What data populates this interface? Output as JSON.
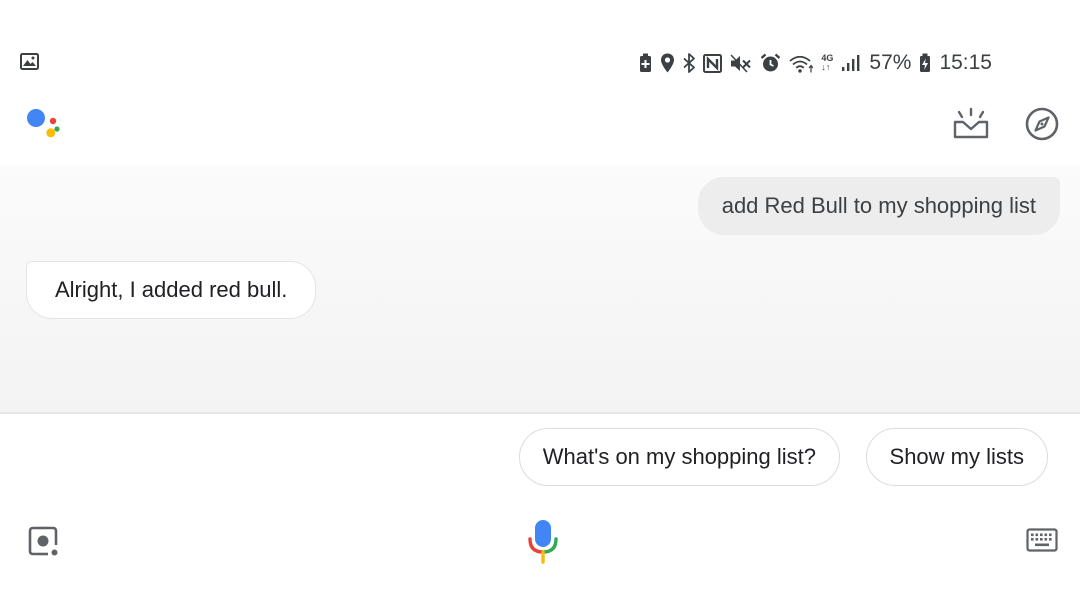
{
  "status_bar": {
    "left_icon": "image-notification-icon",
    "icons": [
      "battery-saver-icon",
      "location-icon",
      "bluetooth-icon",
      "nfc-icon",
      "mute-icon",
      "alarm-icon",
      "wifi-icon",
      "network-4g-icon",
      "signal-icon"
    ],
    "network_top": "4G",
    "network_bottom": "↓↑",
    "battery_percent": "57%",
    "time": "15:15"
  },
  "header": {
    "logo_icon": "google-assistant-logo",
    "updates_icon": "updates-icon",
    "explore_icon": "explore-compass-icon"
  },
  "conversation": {
    "user_message": "add Red Bull to my shopping list",
    "assistant_reply": "Alright, I added red bull."
  },
  "suggestions": [
    "What's on my shopping list?",
    "Show my lists"
  ],
  "bottom_bar": {
    "lens_icon": "lens-icon",
    "mic_icon": "microphone-icon",
    "keyboard_icon": "keyboard-icon"
  },
  "colors": {
    "google_blue": "#4285F4",
    "google_red": "#EA4335",
    "google_yellow": "#FBBC05",
    "google_green": "#34A853",
    "icon_gray": "#5f6368"
  }
}
